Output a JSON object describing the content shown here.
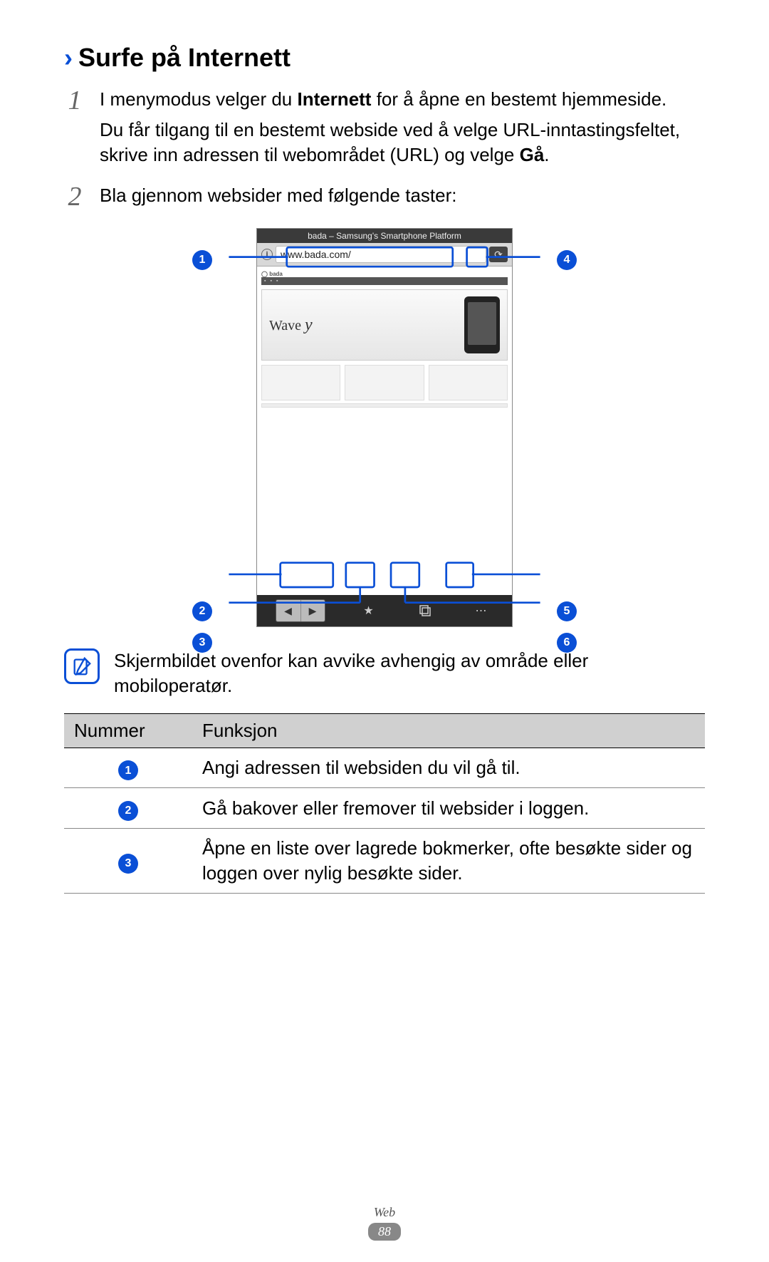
{
  "heading": "Surfe på Internett",
  "step1": {
    "num": "1",
    "line1_pre": "I menymodus velger du ",
    "line1_bold": "Internett",
    "line1_post": " for å åpne en bestemt hjemmeside.",
    "line2_pre": "Du får tilgang til en bestemt webside ved å velge URL-inntastingsfeltet, skrive inn adressen til webområdet (URL) og velge ",
    "line2_bold": "Gå",
    "line2_post": "."
  },
  "step2": {
    "num": "2",
    "text": "Bla gjennom websider med følgende taster:"
  },
  "phone": {
    "title": "bada – Samsung's Smartphone Platform",
    "url": "www.bada.com/",
    "wave": "Wave",
    "wave_y": "y",
    "logo": "bada"
  },
  "callouts": {
    "c1": "1",
    "c2": "2",
    "c3": "3",
    "c4": "4",
    "c5": "5",
    "c6": "6"
  },
  "note": "Skjermbildet ovenfor kan avvike avhengig av område eller mobiloperatør.",
  "table": {
    "h1": "Nummer",
    "h2": "Funksjon",
    "rows": [
      {
        "n": "1",
        "f": "Angi adressen til websiden du vil gå til."
      },
      {
        "n": "2",
        "f": "Gå bakover eller fremover til websider i loggen."
      },
      {
        "n": "3",
        "f": "Åpne en liste over lagrede bokmerker, ofte besøkte sider og loggen over nylig besøkte sider."
      }
    ]
  },
  "footer": {
    "section": "Web",
    "page": "88"
  }
}
